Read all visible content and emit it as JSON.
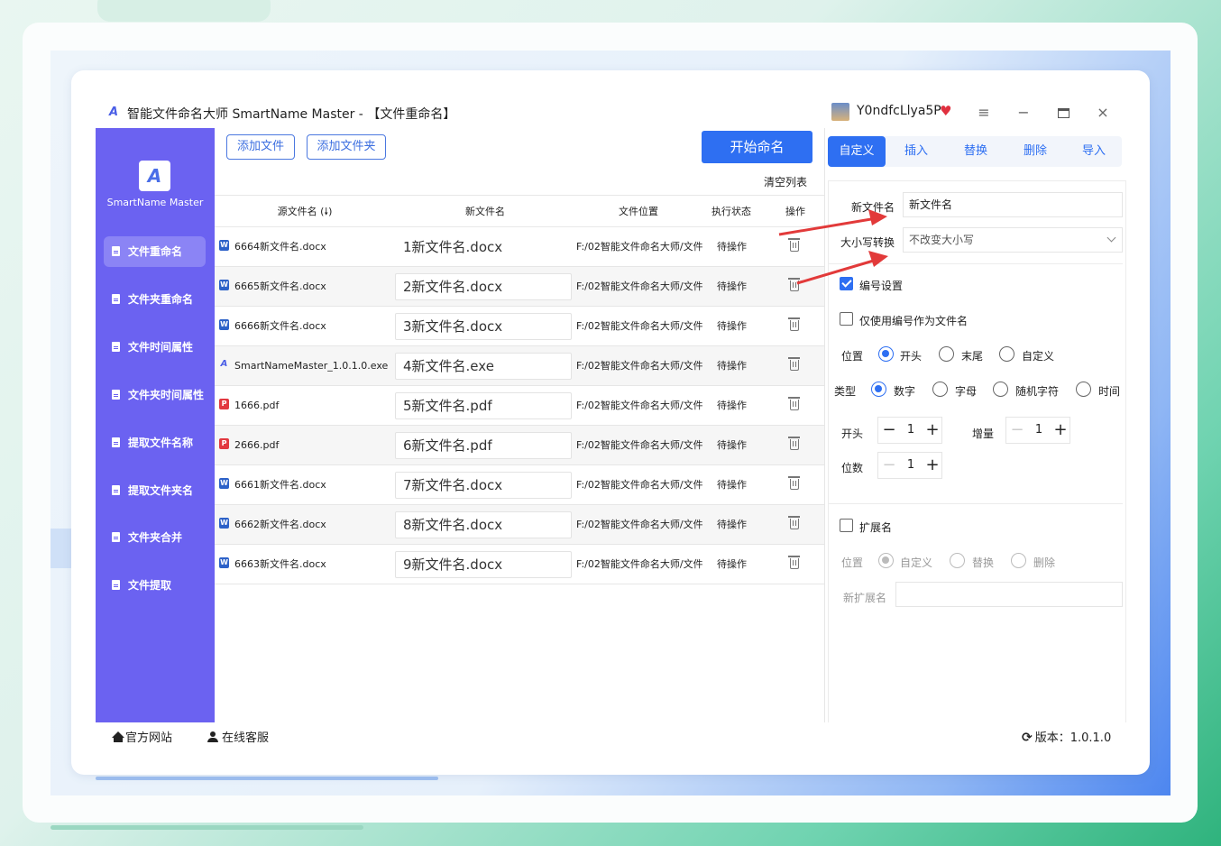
{
  "window": {
    "title": "智能文件命名大师 SmartName Master - 【文件重命名】",
    "username": "Y0ndfcLlya5P"
  },
  "sidebar": {
    "logo_text": "SmartName Master",
    "items": [
      {
        "label": "文件重命名"
      },
      {
        "label": "文件夹重命名"
      },
      {
        "label": "文件时间属性"
      },
      {
        "label": "文件夹时间属性"
      },
      {
        "label": "提取文件名称"
      },
      {
        "label": "提取文件夹名"
      },
      {
        "label": "文件夹合并"
      },
      {
        "label": "文件提取"
      }
    ]
  },
  "toolbar": {
    "add_file": "添加文件",
    "add_folder": "添加文件夹",
    "start": "开始命名",
    "clear": "清空列表"
  },
  "table": {
    "headers": [
      "源文件名 (🠗)",
      "新文件名",
      "文件位置",
      "执行状态",
      "操作"
    ],
    "rows": [
      {
        "type": "word",
        "src": "6664新文件名.docx",
        "new": "1新文件名.docx",
        "loc": "F:/02智能文件命名大师/文件",
        "status": "待操作"
      },
      {
        "type": "word",
        "src": "6665新文件名.docx",
        "new": "2新文件名.docx",
        "loc": "F:/02智能文件命名大师/文件",
        "status": "待操作"
      },
      {
        "type": "word",
        "src": "6666新文件名.docx",
        "new": "3新文件名.docx",
        "loc": "F:/02智能文件命名大师/文件",
        "status": "待操作"
      },
      {
        "type": "exe",
        "src": "SmartNameMaster_1.0.1.0.exe",
        "new": "4新文件名.exe",
        "loc": "F:/02智能文件命名大师/文件",
        "status": "待操作"
      },
      {
        "type": "pdf",
        "src": "1666.pdf",
        "new": "5新文件名.pdf",
        "loc": "F:/02智能文件命名大师/文件",
        "status": "待操作"
      },
      {
        "type": "pdf",
        "src": "2666.pdf",
        "new": "6新文件名.pdf",
        "loc": "F:/02智能文件命名大师/文件",
        "status": "待操作"
      },
      {
        "type": "word",
        "src": "6661新文件名.docx",
        "new": "7新文件名.docx",
        "loc": "F:/02智能文件命名大师/文件",
        "status": "待操作"
      },
      {
        "type": "word",
        "src": "6662新文件名.docx",
        "new": "8新文件名.docx",
        "loc": "F:/02智能文件命名大师/文件",
        "status": "待操作"
      },
      {
        "type": "word",
        "src": "6663新文件名.docx",
        "new": "9新文件名.docx",
        "loc": "F:/02智能文件命名大师/文件",
        "status": "待操作"
      }
    ]
  },
  "panel": {
    "tabs": [
      "自定义",
      "插入",
      "替换",
      "删除",
      "导入"
    ],
    "new_name_label": "新文件名",
    "new_name_value": "新文件名",
    "case_label": "大小写转换",
    "case_value": "不改变大小写",
    "numbering_label": "编号设置",
    "only_number_label": "仅使用编号作为文件名",
    "position_label": "位置",
    "position_options": [
      "开头",
      "末尾",
      "自定义"
    ],
    "type_label": "类型",
    "type_options": [
      "数字",
      "字母",
      "随机字符",
      "时间"
    ],
    "start_label": "开头",
    "start_value": "1",
    "increment_label": "增量",
    "increment_value": "1",
    "digits_label": "位数",
    "digits_value": "1",
    "ext_label": "扩展名",
    "ext_position_label": "位置",
    "ext_options": [
      "自定义",
      "替换",
      "删除"
    ],
    "new_ext_label": "新扩展名",
    "new_ext_value": ""
  },
  "footer": {
    "website": "官方网站",
    "support": "在线客服",
    "version": "版本：1.0.1.0"
  },
  "colors": {
    "accent": "#2e6ff2",
    "sidebar": "#6b62f1",
    "arrow": "#e23a3a"
  }
}
